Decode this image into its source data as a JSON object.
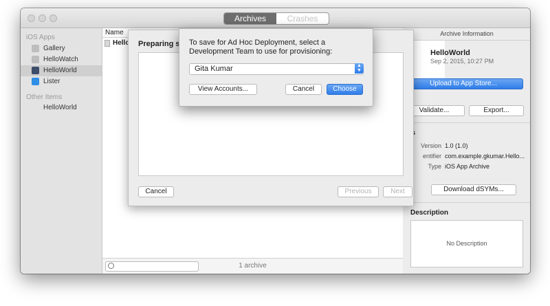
{
  "toolbar": {
    "tabs": [
      {
        "label": "Archives",
        "active": true
      },
      {
        "label": "Crashes",
        "active": false
      }
    ]
  },
  "sidebar": {
    "groups": [
      {
        "header": "iOS Apps",
        "items": [
          {
            "label": "Gallery",
            "icon": "app-icon"
          },
          {
            "label": "HelloWatch",
            "icon": "app-icon"
          },
          {
            "label": "HelloWorld",
            "icon": "app-icon",
            "selected": true
          },
          {
            "label": "Lister",
            "icon": "app-icon"
          }
        ]
      },
      {
        "header": "Other Items",
        "items": [
          {
            "label": "HelloWorld",
            "icon": "none"
          }
        ]
      }
    ]
  },
  "list": {
    "column_header": "Name",
    "row_name": "Hello",
    "footer_count": "1 archive"
  },
  "info": {
    "title": "Archive Information",
    "app_name": "HelloWorld",
    "date": "Sep 2, 2015, 10:27 PM",
    "upload_button": "Upload to App Store...",
    "validate_button": "Validate...",
    "export_button": "Export...",
    "details_header": "ils",
    "version_label": "Version",
    "version_value": "1.0 (1.0)",
    "identifier_label": "entifier",
    "identifier_value": "com.example.gkumar.Hello...",
    "type_label": "Type",
    "type_value": "iOS App Archive",
    "download_button": "Download dSYMs...",
    "description_header": "Description",
    "description_placeholder": "No Description"
  },
  "sheet": {
    "title": "Preparing si",
    "cancel_button": "Cancel",
    "previous_button": "Previous",
    "next_button": "Next"
  },
  "alert": {
    "message": "To save for Ad Hoc Deployment, select a Development Team to use for provisioning:",
    "team_value": "Gita Kumar",
    "view_accounts_button": "View Accounts...",
    "cancel_button": "Cancel",
    "choose_button": "Choose"
  },
  "colors": {
    "accent": "#2f7de9",
    "selection": "#cfcfcf"
  }
}
